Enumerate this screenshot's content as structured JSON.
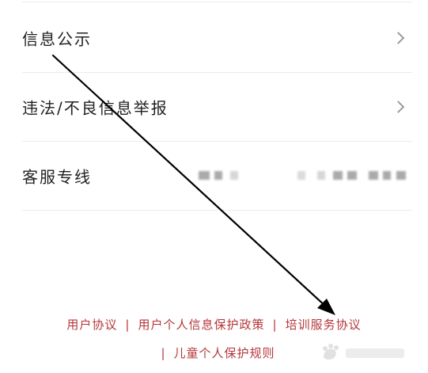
{
  "menu": {
    "items": [
      {
        "label": "信息公示"
      },
      {
        "label": "违法/不良信息举报"
      },
      {
        "label": "客服专线"
      }
    ]
  },
  "footer": {
    "links": [
      {
        "label": "用户协议"
      },
      {
        "label": "用户个人信息保护政策"
      },
      {
        "label": "培训服务协议"
      },
      {
        "label": "儿童个人保护规则"
      }
    ],
    "separator": "|"
  },
  "colors": {
    "footer_link": "#b5363a",
    "text": "#222222",
    "divider": "#ececec",
    "chevron": "#9a9a9a",
    "arrow": "#000000"
  },
  "icons": {
    "chevron": "chevron-right-icon",
    "arrow": "annotation-arrow-icon",
    "watermark": "baidu-watermark-logo"
  }
}
